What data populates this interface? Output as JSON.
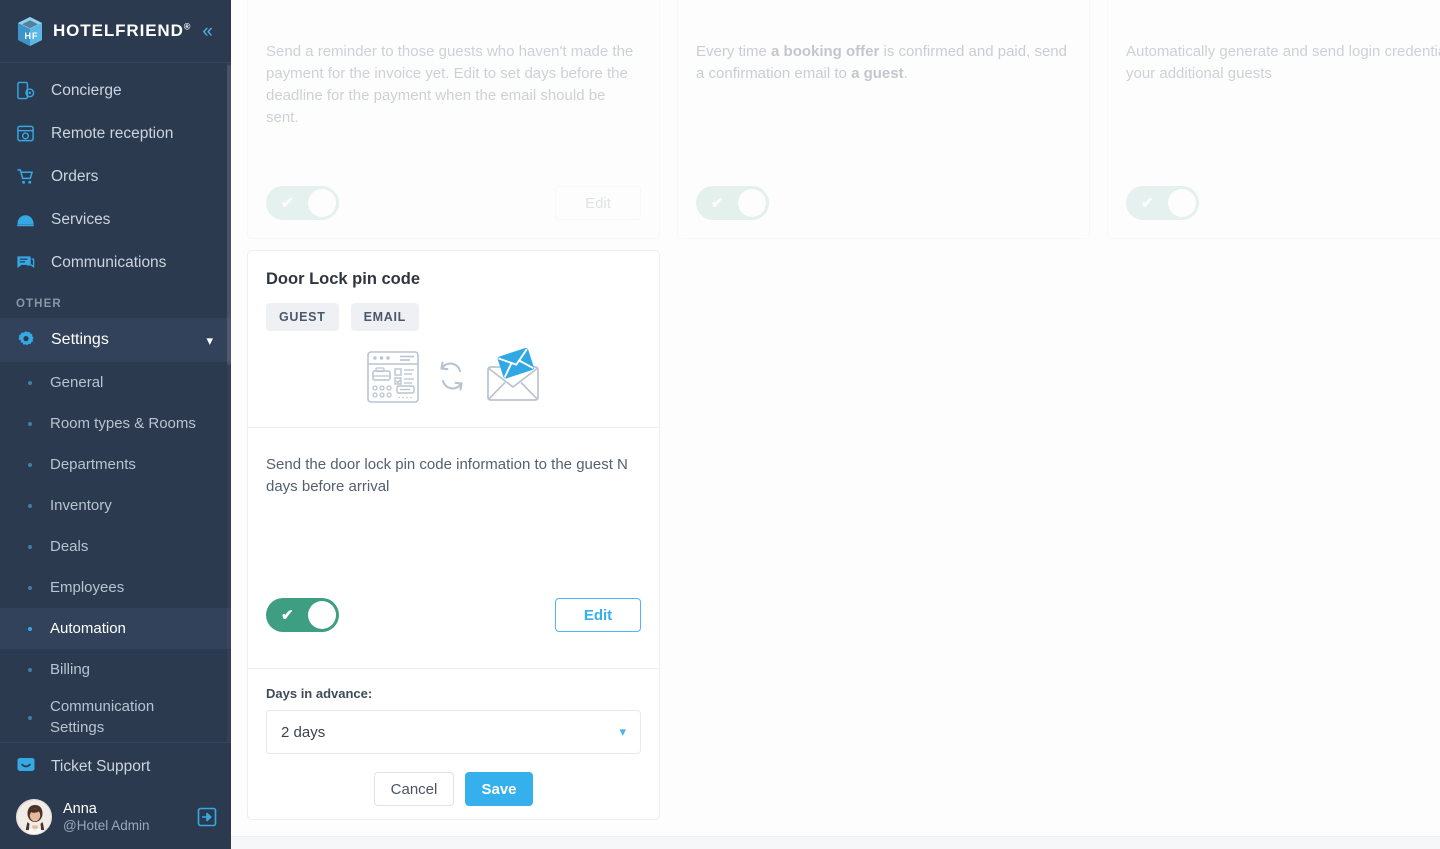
{
  "brand": {
    "name": "HOTELFRIEND",
    "registered": "®",
    "collapse_icon": "chevron-double-left-icon"
  },
  "sidebar": {
    "nav": [
      {
        "label": "Concierge",
        "icon": "concierge-mobile-icon"
      },
      {
        "label": "Remote reception",
        "icon": "remote-reception-icon"
      },
      {
        "label": "Orders",
        "icon": "cart-icon"
      },
      {
        "label": "Services",
        "icon": "room-service-bell-icon"
      },
      {
        "label": "Communications",
        "icon": "chat-bubble-icon"
      }
    ],
    "section_label": "OTHER",
    "settings": {
      "label": "Settings",
      "icon": "gear-icon",
      "chevron": "chevron-down-icon"
    },
    "sub_items": [
      {
        "label": "General",
        "active": false
      },
      {
        "label": "Room types & Rooms",
        "active": false
      },
      {
        "label": "Departments",
        "active": false
      },
      {
        "label": "Inventory",
        "active": false
      },
      {
        "label": "Deals",
        "active": false
      },
      {
        "label": "Employees",
        "active": false
      },
      {
        "label": "Automation",
        "active": true
      },
      {
        "label": "Billing",
        "active": false
      },
      {
        "label": "Communication Settings",
        "active": false
      }
    ],
    "ticket_support": {
      "label": "Ticket Support",
      "icon": "support-chat-icon"
    },
    "user": {
      "name": "Anna",
      "role": "@Hotel Admin",
      "avatar": "user-avatar",
      "logout_icon": "logout-arrow-icon"
    }
  },
  "cards": {
    "faded": [
      {
        "desc": "Send a reminder to those guests who haven't made the payment for the invoice yet. Edit to set days before the deadline for the payment when the email should be sent.",
        "toggle_on": true,
        "edit_label": "Edit",
        "has_edit": true
      },
      {
        "desc_parts": [
          {
            "text": "Every time ",
            "bold": false
          },
          {
            "text": "a booking offer",
            "bold": true
          },
          {
            "text": " is confirmed and paid, send a confirmation email to ",
            "bold": false
          },
          {
            "text": "a guest",
            "bold": true
          },
          {
            "text": ".",
            "bold": false
          }
        ],
        "toggle_on": true,
        "has_edit": false
      },
      {
        "desc": "Automatically generate and send login credentials to your additional guests",
        "toggle_on": true,
        "has_edit": false
      }
    ],
    "active": {
      "title": "Door Lock pin code",
      "badges": [
        "GUEST",
        "EMAIL"
      ],
      "illustration": [
        "booking-screen-icon",
        "sync-arrows-icon",
        "email-send-icon"
      ],
      "desc": "Send the door lock pin code information to the guest N days before arrival",
      "toggle_on": true,
      "edit_label": "Edit",
      "form": {
        "label": "Days in advance:",
        "select_value": "2 days",
        "select_chevron": "chevron-down-icon",
        "cancel_label": "Cancel",
        "save_label": "Save"
      }
    }
  },
  "colors": {
    "sidebar_bg": "#2b3a4f",
    "accent_blue": "#35b0ec",
    "toggle_green": "#3d9e81",
    "page_bg": "#fdfdfe"
  }
}
